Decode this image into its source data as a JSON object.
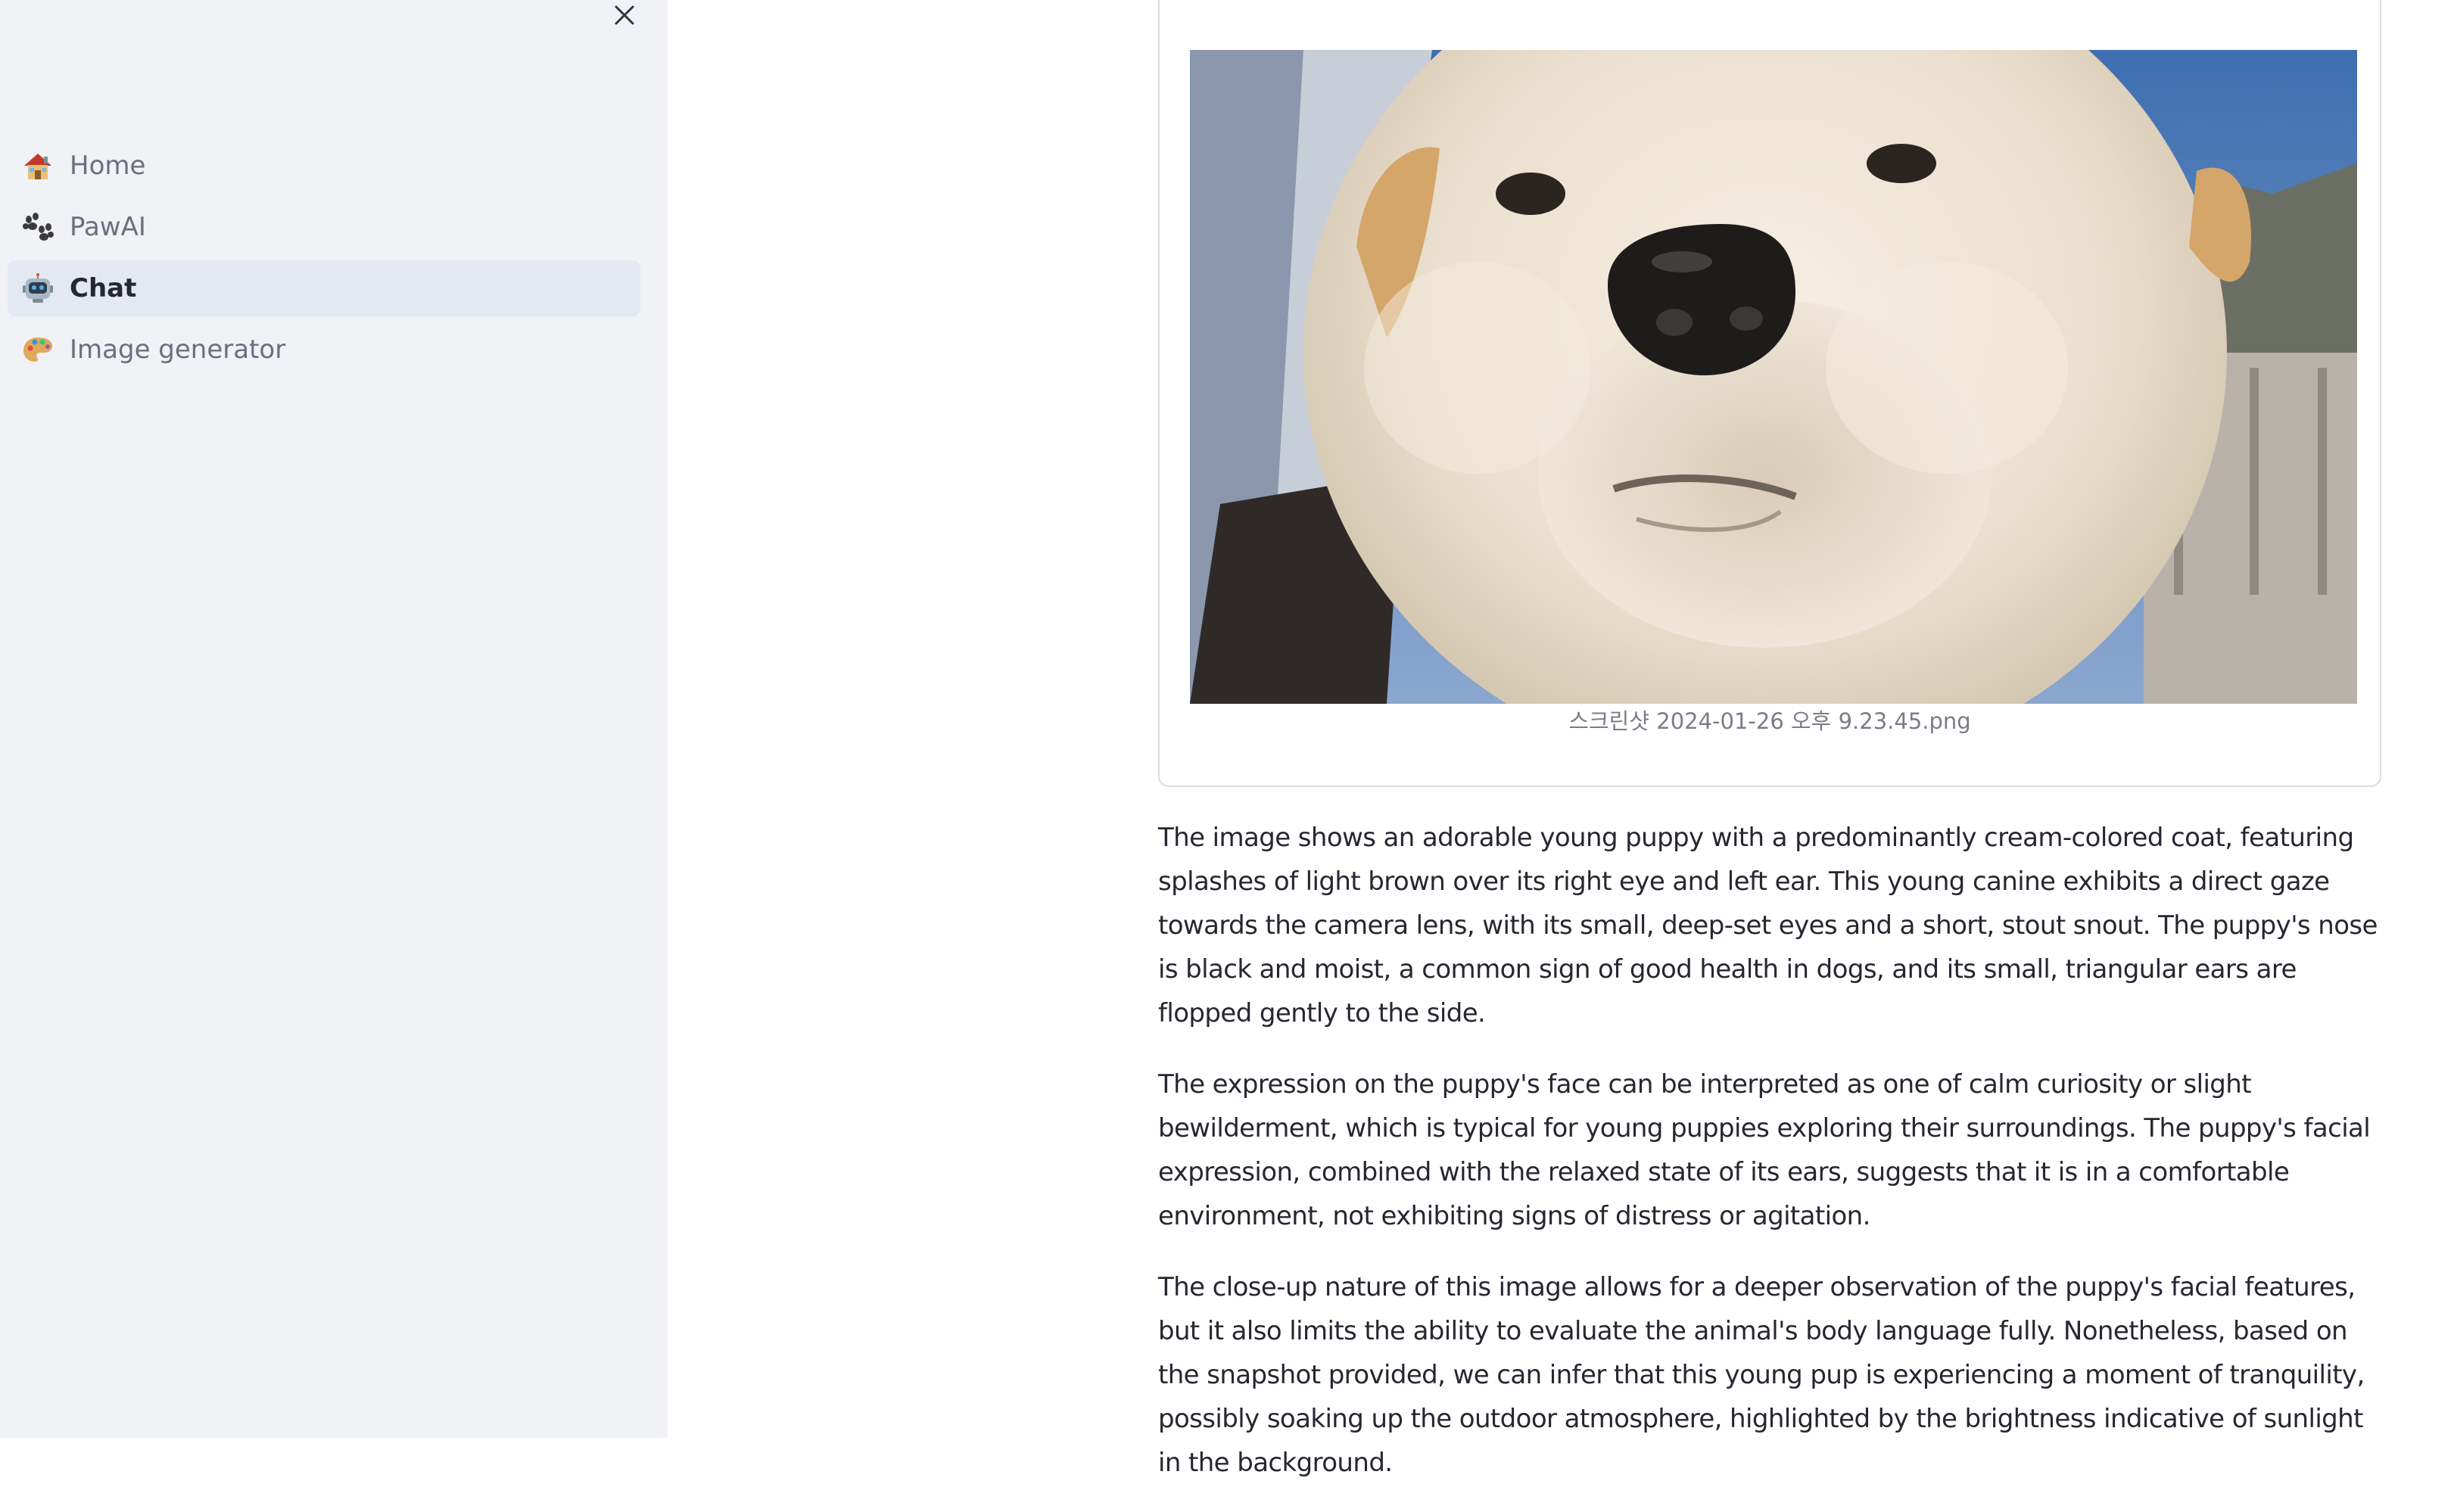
{
  "sidebar": {
    "close_icon": "close-icon",
    "items": [
      {
        "label": "Home",
        "icon": "house-icon",
        "active": false
      },
      {
        "label": "PawAI",
        "icon": "paw-icon",
        "active": false
      },
      {
        "label": "Chat",
        "icon": "robot-icon",
        "active": true
      },
      {
        "label": "Image generator",
        "icon": "palette-icon",
        "active": false
      }
    ]
  },
  "main": {
    "image_card": {
      "image": "puppy-photo",
      "caption": "스크린샷 2024-01-26 오후 9.23.45.png"
    },
    "reply": {
      "paragraphs": [
        "The image shows an adorable young puppy with a predominantly cream-colored coat, featuring splashes of light brown over its right eye and left ear. This young canine exhibits a direct gaze towards the camera lens, with its small, deep-set eyes and a short, stout snout. The puppy's nose is black and moist, a common sign of good health in dogs, and its small, triangular ears are flopped gently to the side.",
        "The expression on the puppy's face can be interpreted as one of calm curiosity or slight bewilderment, which is typical for young puppies exploring their surroundings. The puppy's facial expression, combined with the relaxed state of its ears, suggests that it is in a comfortable environment, not exhibiting signs of distress or agitation.",
        "The close-up nature of this image allows for a deeper observation of the puppy's facial features, but it also limits the ability to evaluate the animal's body language fully. Nonetheless, based on the snapshot provided, we can infer that this young pup is experiencing a moment of tranquility, possibly soaking up the outdoor atmosphere, highlighted by the brightness indicative of sunlight in the background."
      ]
    }
  },
  "colors": {
    "sidebar_bg": "#f0f2f6",
    "active_item_bg": "#e4e8f0",
    "text": "#262730",
    "muted_text": "#6b6f7e"
  }
}
